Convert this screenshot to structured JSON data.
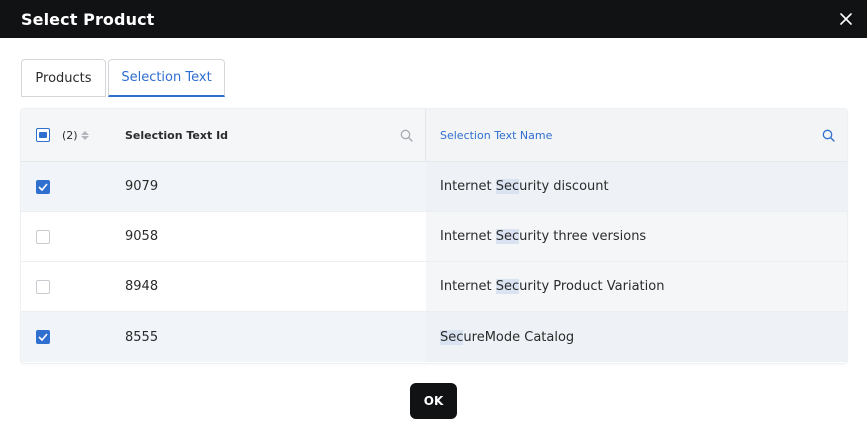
{
  "dialog": {
    "title": "Select Product",
    "ok_label": "OK"
  },
  "tabs": [
    {
      "label": "Products",
      "active": false
    },
    {
      "label": "Selection Text",
      "active": true
    }
  ],
  "grid": {
    "selected_count": "(2)",
    "columns": {
      "id": "Selection Text Id",
      "name": "Selection Text Name"
    },
    "rows": [
      {
        "checked": true,
        "id": "9079",
        "name_pre": "Internet ",
        "name_hl": "Sec",
        "name_post": "urity discount"
      },
      {
        "checked": false,
        "id": "9058",
        "name_pre": "Internet ",
        "name_hl": "Sec",
        "name_post": "urity three versions"
      },
      {
        "checked": false,
        "id": "8948",
        "name_pre": "Internet ",
        "name_hl": "Sec",
        "name_post": "urity Product Variation"
      },
      {
        "checked": true,
        "id": "8555",
        "name_pre": "",
        "name_hl": "Sec",
        "name_post": "ureMode Catalog"
      }
    ]
  },
  "colors": {
    "accent": "#2f6fcf",
    "titlebar": "#111214",
    "highlight": "#d9e3f2"
  },
  "icons": [
    "close-icon",
    "search-icon",
    "sort-icon",
    "checkmark-icon"
  ]
}
